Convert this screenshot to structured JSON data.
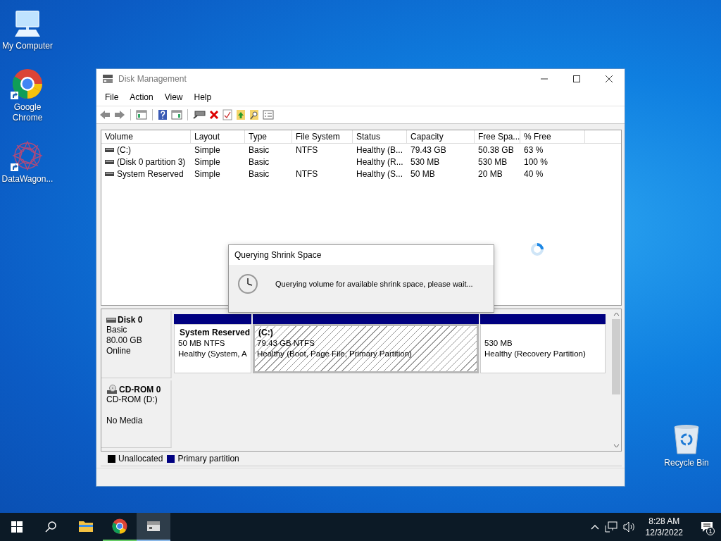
{
  "desktop_icons": [
    {
      "label": "My Computer",
      "kind": "computer",
      "shortcut": false
    },
    {
      "label": "Google Chrome",
      "kind": "chrome",
      "shortcut": true
    },
    {
      "label": "DataWagon...",
      "kind": "datawagon",
      "shortcut": true
    },
    {
      "label": "Recycle Bin",
      "kind": "recycle",
      "shortcut": false
    }
  ],
  "window": {
    "title": "Disk Management",
    "menu": [
      "File",
      "Action",
      "View",
      "Help"
    ],
    "table": {
      "columns": [
        "Volume",
        "Layout",
        "Type",
        "File System",
        "Status",
        "Capacity",
        "Free Spa...",
        "% Free"
      ],
      "rows": [
        [
          "(C:)",
          "Simple",
          "Basic",
          "NTFS",
          "Healthy (B...",
          "79.43 GB",
          "50.38 GB",
          "63 %"
        ],
        [
          "(Disk 0 partition 3)",
          "Simple",
          "Basic",
          "",
          "Healthy (R...",
          "530 MB",
          "530 MB",
          "100 %"
        ],
        [
          "System Reserved",
          "Simple",
          "Basic",
          "NTFS",
          "Healthy (S...",
          "50 MB",
          "20 MB",
          "40 %"
        ]
      ]
    },
    "disks": [
      {
        "kind": "disk",
        "name": "Disk 0",
        "info": [
          "Basic",
          "80.00 GB"
        ],
        "status": "Online",
        "partitions": [
          {
            "name": "System Reserved",
            "size": "50 MB NTFS",
            "health": "Healthy (System, A",
            "selected": false
          },
          {
            "name": "(C:)",
            "size": "79.43 GB NTFS",
            "health": "Healthy (Boot, Page File, Primary Partition)",
            "selected": true
          },
          {
            "size": "530 MB",
            "health": "Healthy (Recovery Partition)",
            "selected": false
          }
        ]
      },
      {
        "kind": "cdrom",
        "name": "CD-ROM 0",
        "info": [
          "CD-ROM (D:)"
        ],
        "status": "No Media"
      }
    ],
    "legend": [
      {
        "label": "Unallocated",
        "color": "#000000"
      },
      {
        "label": "Primary partition",
        "color": "#000080"
      }
    ]
  },
  "dialog": {
    "title": "Querying Shrink Space",
    "message": "Querying volume for available shrink space, please wait..."
  },
  "taskbar": {
    "apps": [
      {
        "kind": "explorer",
        "running": false
      },
      {
        "kind": "chrome",
        "running": true
      },
      {
        "kind": "diskmgmt",
        "running": true
      }
    ],
    "time": "8:28 AM",
    "date": "12/3/2022",
    "notifications": "1"
  }
}
